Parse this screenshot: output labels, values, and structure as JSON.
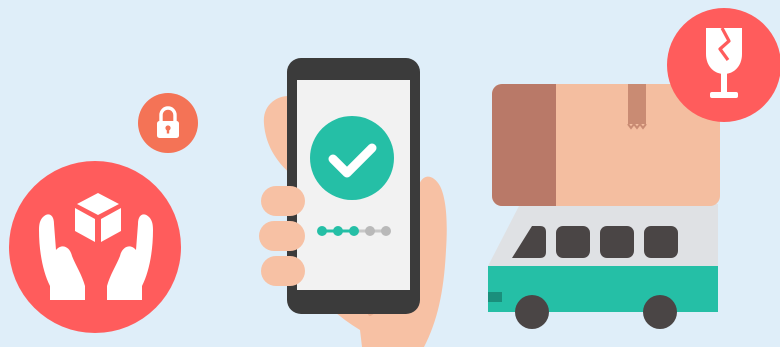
{
  "scene": {
    "background_color": "#dfeef9",
    "icons": {
      "lock": "lock-icon",
      "care": "hands-holding-box-icon",
      "fragile": "broken-glass-icon",
      "phone": "smartphone-icon",
      "check": "checkmark-icon",
      "truck": "delivery-truck-icon",
      "package": "cardboard-box-icon"
    },
    "colors": {
      "coral": "#ff5c5c",
      "lock_orange": "#f47356",
      "check_teal": "#25bfa6",
      "truck_teal": "#25bfa6",
      "skin": "#f7c1a4",
      "box": "#f4bea0",
      "box_flap": "#b97968",
      "window": "#4a4545",
      "phone_body": "#3b3b3b",
      "phone_screen": "#f2f2f2"
    },
    "progress": {
      "completed_steps": 3,
      "total_steps": 5
    }
  }
}
